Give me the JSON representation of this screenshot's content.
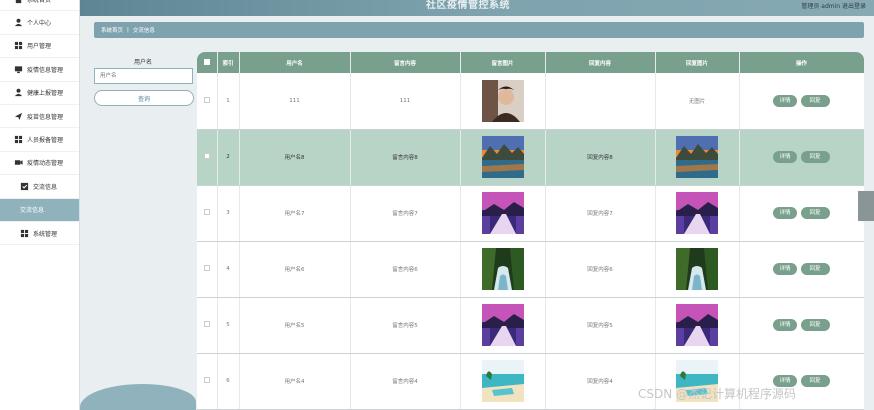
{
  "header": {
    "title": "社区疫情管控系统",
    "user": "管理员 admin   退出登录"
  },
  "sidebar": {
    "items": [
      {
        "label": "系统首页",
        "icon": "home-icon",
        "sub": false
      },
      {
        "label": "个人中心",
        "icon": "user-icon",
        "sub": false
      },
      {
        "label": "用户管理",
        "icon": "grid-icon",
        "sub": false
      },
      {
        "label": "疫情信息管理",
        "icon": "monitor-icon",
        "sub": false
      },
      {
        "label": "健康上报管理",
        "icon": "user-icon",
        "sub": false
      },
      {
        "label": "疫苗信息管理",
        "icon": "send-icon",
        "sub": false
      },
      {
        "label": "人员报备管理",
        "icon": "grid-icon",
        "sub": false
      },
      {
        "label": "疫情动态管理",
        "icon": "camera-icon",
        "sub": false
      },
      {
        "label": "交流信息",
        "icon": "check-icon",
        "sub": true
      },
      {
        "label": "交流信息",
        "icon": "",
        "sub": true,
        "active": true
      },
      {
        "label": "系统管理",
        "icon": "grid-icon",
        "sub": true
      }
    ]
  },
  "breadcrumb": {
    "home": "系统首页",
    "sep": "|",
    "current": "交流信息"
  },
  "search": {
    "label": "用户名",
    "placeholder": "用户名",
    "button": "查询"
  },
  "table": {
    "headers": [
      "",
      "索引",
      "用户名",
      "留言内容",
      "留言图片",
      "回复内容",
      "回复图片",
      "操作"
    ],
    "rows": [
      {
        "index": "1",
        "user": "111",
        "msg": "111",
        "img": "portrait",
        "reply": "",
        "reply_img": "无图片",
        "hl": false
      },
      {
        "index": "2",
        "user": "用户名8",
        "msg": "留言内容8",
        "img": "lake",
        "reply": "回复内容8",
        "reply_img": "lake",
        "hl": true
      },
      {
        "index": "3",
        "user": "用户名7",
        "msg": "留言内容7",
        "img": "purple",
        "reply": "回复内容7",
        "reply_img": "purple",
        "hl": false
      },
      {
        "index": "4",
        "user": "用户名6",
        "msg": "留言内容6",
        "img": "forest",
        "reply": "回复内容6",
        "reply_img": "forest",
        "hl": false
      },
      {
        "index": "5",
        "user": "用户名5",
        "msg": "留言内容5",
        "img": "purple",
        "reply": "回复内容5",
        "reply_img": "purple",
        "hl": false
      },
      {
        "index": "6",
        "user": "用户名4",
        "msg": "留言内容4",
        "img": "beach",
        "reply": "回复内容4",
        "reply_img": "beach",
        "hl": false
      }
    ],
    "detail_label": "详情",
    "reply_label": "回复"
  },
  "watermark": "CSDN @杰记计算机程序源码"
}
